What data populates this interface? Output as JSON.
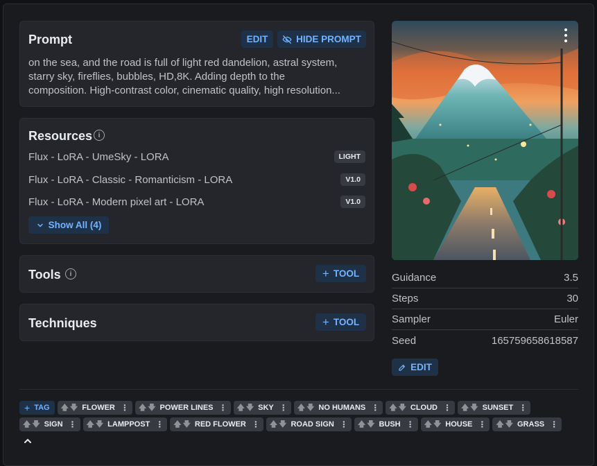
{
  "prompt": {
    "title": "Prompt",
    "edit_label": "EDIT",
    "hide_label": "HIDE PROMPT",
    "lines": [
      "on the sea, and the road is full of light red dandelion, astral system,",
      "starry sky, fireflies, bubbles, HD,8K. Adding depth to the",
      "composition. High-contrast color, cinematic quality, high resolution..."
    ]
  },
  "resources": {
    "title": "Resources",
    "items": [
      {
        "name": "Flux - LoRA - UmeSky - LORA",
        "badge": "LIGHT"
      },
      {
        "name": "Flux - LoRA - Classic - Romanticism - LORA",
        "badge": "V1.0"
      },
      {
        "name": "Flux - LoRA - Modern pixel art - LORA",
        "badge": "V1.0"
      }
    ],
    "show_all_label": "Show All (4)"
  },
  "tools": {
    "title": "Tools",
    "add_label": "TOOL"
  },
  "techniques": {
    "title": "Techniques",
    "add_label": "TOOL"
  },
  "params": [
    {
      "label": "Guidance",
      "value": "3.5"
    },
    {
      "label": "Steps",
      "value": "30"
    },
    {
      "label": "Sampler",
      "value": "Euler"
    },
    {
      "label": "Seed",
      "value": "165759658618587"
    }
  ],
  "params_edit_label": "EDIT",
  "tags": {
    "add_label": "TAG",
    "items": [
      "FLOWER",
      "POWER LINES",
      "SKY",
      "NO HUMANS",
      "CLOUD",
      "SUNSET",
      "SIGN",
      "LAMPPOST",
      "RED FLOWER",
      "ROAD SIGN",
      "BUSH",
      "HOUSE",
      "GRASS"
    ]
  },
  "colors": {
    "accent": "#74b3ff",
    "accent_bg": "#1f3147",
    "card": "#25262b",
    "page": "#1a1b1e"
  }
}
